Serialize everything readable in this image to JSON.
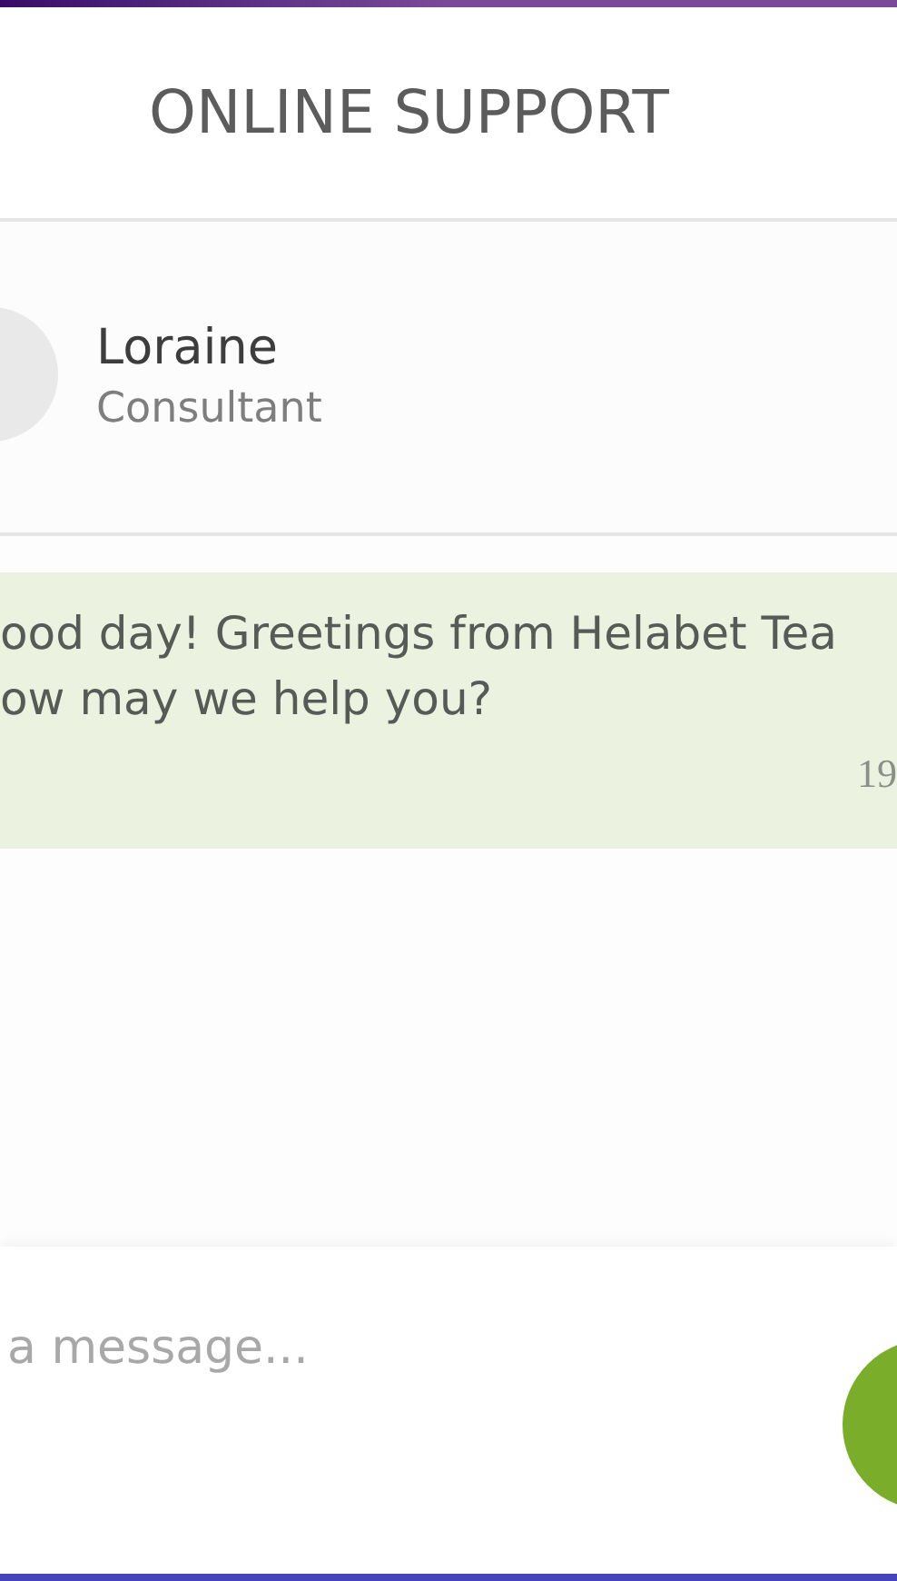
{
  "header": {
    "title": "ONLINE SUPPORT"
  },
  "agent": {
    "name": "Loraine",
    "role": "Consultant"
  },
  "messages": [
    {
      "lines": [
        "ood day! Greetings from Helabet Tea",
        "ow may we help you?"
      ],
      "time": "19"
    }
  ],
  "composer": {
    "placeholder": "a message..."
  }
}
